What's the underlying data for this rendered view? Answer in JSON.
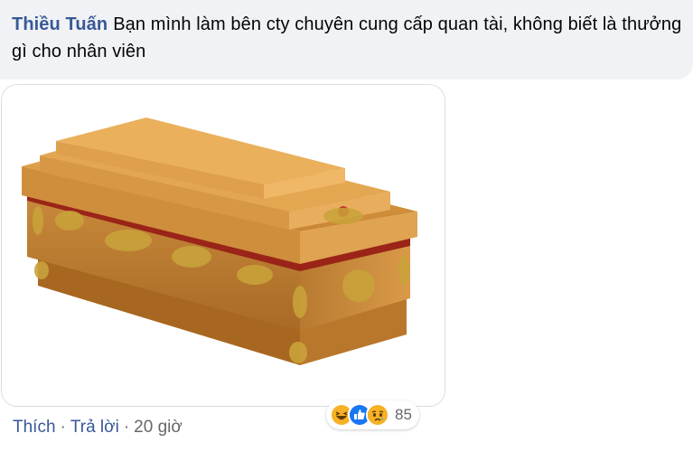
{
  "comment": {
    "author": "Thiều Tuấn",
    "text": "Bạn mình làm bên cty chuyên cung cấp quan tài, không biết là thưởng gì cho nhân viên"
  },
  "actions": {
    "like": "Thích",
    "reply": "Trả lời",
    "time": "20 giờ",
    "separator": "·"
  },
  "reactions": {
    "icons": [
      "haha-icon",
      "like-icon",
      "sad-icon"
    ],
    "count": "85"
  },
  "colors": {
    "author": "#385898",
    "bubble": "#f0f2f5",
    "meta": "#65676b",
    "like_blue": "#1877f2",
    "emoji_yellow": "#f7b125"
  }
}
